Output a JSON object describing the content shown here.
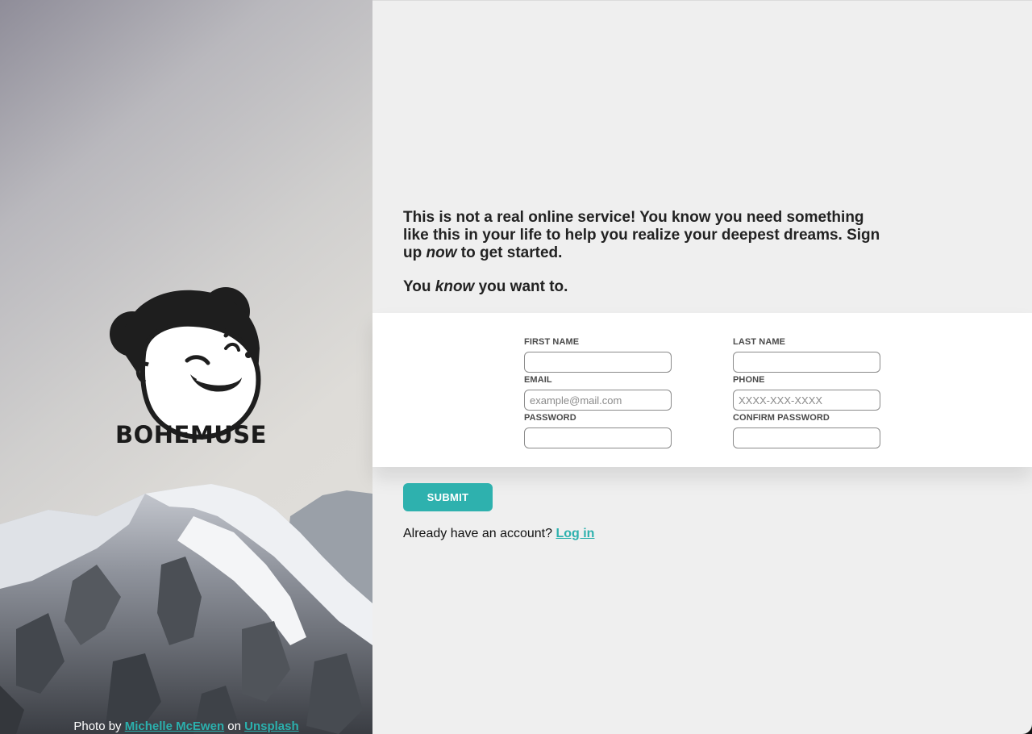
{
  "hero": {
    "brand_name": "BOHEMUSE",
    "credit": {
      "prefix": "Photo by",
      "author": "Michelle McEwen",
      "middle": "on",
      "site": "Unsplash"
    }
  },
  "intro": {
    "line1_a": "This is not a real online service! You know you need something like this in your life to help you realize your deepest dreams. Sign up ",
    "line1_em": "now",
    "line1_b": " to get started.",
    "line2_a": "You ",
    "line2_em": "know",
    "line2_b": " you want to."
  },
  "form": {
    "first_name": {
      "label": "FIRST NAME",
      "value": "",
      "placeholder": ""
    },
    "last_name": {
      "label": "LAST NAME",
      "value": "",
      "placeholder": ""
    },
    "email": {
      "label": "EMAIL",
      "value": "",
      "placeholder": "example@mail.com"
    },
    "phone": {
      "label": "PHONE",
      "value": "",
      "placeholder": "XXXX-XXX-XXXX"
    },
    "password": {
      "label": "PASSWORD",
      "value": "",
      "placeholder": ""
    },
    "confirm_password": {
      "label": "CONFIRM PASSWORD",
      "value": "",
      "placeholder": ""
    }
  },
  "submit_label": "SUBMIT",
  "login": {
    "prompt": "Already have an account?",
    "link": "Log in"
  },
  "colors": {
    "accent": "#2eb1ae",
    "page_bg": "#efefef",
    "panel_bg": "#ffffff"
  }
}
